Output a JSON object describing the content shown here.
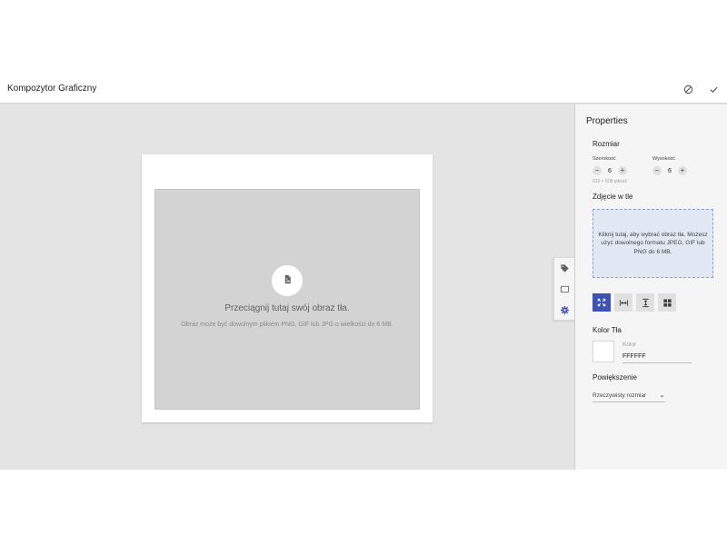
{
  "header": {
    "title": "Kompozytor Graficzny",
    "cancel_icon": "block-icon",
    "confirm_icon": "check-icon"
  },
  "canvas": {
    "drop_icon": "file-image-icon",
    "drop_title": "Przeciągnij tutaj swój obraz tła.",
    "drop_subtitle": "Obraz może być dowolnym plikiem PNG, GIF lub JPG o wielkości do 6 MB."
  },
  "side_tabs": [
    {
      "icon": "tag-icon"
    },
    {
      "icon": "rectangle-icon"
    },
    {
      "icon": "gear-icon",
      "active": true
    }
  ],
  "properties": {
    "title": "Properties",
    "size": {
      "heading": "Rozmiar",
      "width_label": "Szerokość",
      "width_value": "6",
      "height_label": "Wysokość",
      "height_value": "6",
      "pixels_hint": "610 × 508 pikseli"
    },
    "background_image": {
      "heading": "Zdjęcie w tle",
      "upload_text": "Kliknij tutaj, aby wybrać obraz tła. Możesz użyć dowolnego formatu JPEG, GIF lub PNG do 6 MB.",
      "modes": [
        "fit-icon",
        "stretch-horizontal-icon",
        "stretch-vertical-icon",
        "tile-icon"
      ],
      "active_mode": 0
    },
    "background_color": {
      "heading": "Kolor Tła",
      "label": "Kolor",
      "value": "FFFFFF"
    },
    "zoom": {
      "heading": "Powiększenie",
      "value": "Rzeczywisty rozmiar"
    }
  },
  "colors": {
    "accent": "#3f51b5",
    "workspace": "#e4e4e4",
    "dropzone": "#d3d3d3",
    "upload_box": "#e2e8f3"
  }
}
